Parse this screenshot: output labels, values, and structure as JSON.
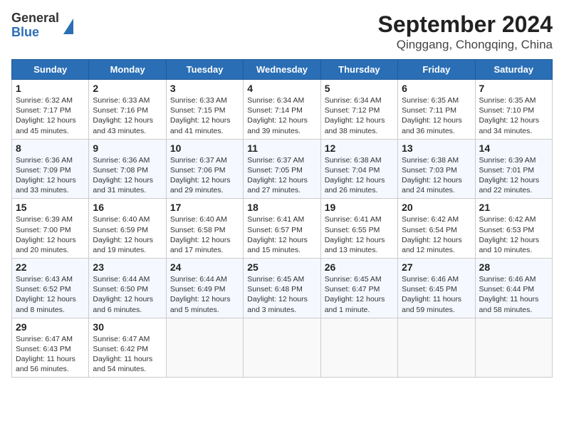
{
  "logo": {
    "line1": "General",
    "line2": "Blue"
  },
  "title": "September 2024",
  "subtitle": "Qinggang, Chongqing, China",
  "days_of_week": [
    "Sunday",
    "Monday",
    "Tuesday",
    "Wednesday",
    "Thursday",
    "Friday",
    "Saturday"
  ],
  "weeks": [
    [
      {
        "day": 1,
        "info": "Sunrise: 6:32 AM\nSunset: 7:17 PM\nDaylight: 12 hours\nand 45 minutes."
      },
      {
        "day": 2,
        "info": "Sunrise: 6:33 AM\nSunset: 7:16 PM\nDaylight: 12 hours\nand 43 minutes."
      },
      {
        "day": 3,
        "info": "Sunrise: 6:33 AM\nSunset: 7:15 PM\nDaylight: 12 hours\nand 41 minutes."
      },
      {
        "day": 4,
        "info": "Sunrise: 6:34 AM\nSunset: 7:14 PM\nDaylight: 12 hours\nand 39 minutes."
      },
      {
        "day": 5,
        "info": "Sunrise: 6:34 AM\nSunset: 7:12 PM\nDaylight: 12 hours\nand 38 minutes."
      },
      {
        "day": 6,
        "info": "Sunrise: 6:35 AM\nSunset: 7:11 PM\nDaylight: 12 hours\nand 36 minutes."
      },
      {
        "day": 7,
        "info": "Sunrise: 6:35 AM\nSunset: 7:10 PM\nDaylight: 12 hours\nand 34 minutes."
      }
    ],
    [
      {
        "day": 8,
        "info": "Sunrise: 6:36 AM\nSunset: 7:09 PM\nDaylight: 12 hours\nand 33 minutes."
      },
      {
        "day": 9,
        "info": "Sunrise: 6:36 AM\nSunset: 7:08 PM\nDaylight: 12 hours\nand 31 minutes."
      },
      {
        "day": 10,
        "info": "Sunrise: 6:37 AM\nSunset: 7:06 PM\nDaylight: 12 hours\nand 29 minutes."
      },
      {
        "day": 11,
        "info": "Sunrise: 6:37 AM\nSunset: 7:05 PM\nDaylight: 12 hours\nand 27 minutes."
      },
      {
        "day": 12,
        "info": "Sunrise: 6:38 AM\nSunset: 7:04 PM\nDaylight: 12 hours\nand 26 minutes."
      },
      {
        "day": 13,
        "info": "Sunrise: 6:38 AM\nSunset: 7:03 PM\nDaylight: 12 hours\nand 24 minutes."
      },
      {
        "day": 14,
        "info": "Sunrise: 6:39 AM\nSunset: 7:01 PM\nDaylight: 12 hours\nand 22 minutes."
      }
    ],
    [
      {
        "day": 15,
        "info": "Sunrise: 6:39 AM\nSunset: 7:00 PM\nDaylight: 12 hours\nand 20 minutes."
      },
      {
        "day": 16,
        "info": "Sunrise: 6:40 AM\nSunset: 6:59 PM\nDaylight: 12 hours\nand 19 minutes."
      },
      {
        "day": 17,
        "info": "Sunrise: 6:40 AM\nSunset: 6:58 PM\nDaylight: 12 hours\nand 17 minutes."
      },
      {
        "day": 18,
        "info": "Sunrise: 6:41 AM\nSunset: 6:57 PM\nDaylight: 12 hours\nand 15 minutes."
      },
      {
        "day": 19,
        "info": "Sunrise: 6:41 AM\nSunset: 6:55 PM\nDaylight: 12 hours\nand 13 minutes."
      },
      {
        "day": 20,
        "info": "Sunrise: 6:42 AM\nSunset: 6:54 PM\nDaylight: 12 hours\nand 12 minutes."
      },
      {
        "day": 21,
        "info": "Sunrise: 6:42 AM\nSunset: 6:53 PM\nDaylight: 12 hours\nand 10 minutes."
      }
    ],
    [
      {
        "day": 22,
        "info": "Sunrise: 6:43 AM\nSunset: 6:52 PM\nDaylight: 12 hours\nand 8 minutes."
      },
      {
        "day": 23,
        "info": "Sunrise: 6:44 AM\nSunset: 6:50 PM\nDaylight: 12 hours\nand 6 minutes."
      },
      {
        "day": 24,
        "info": "Sunrise: 6:44 AM\nSunset: 6:49 PM\nDaylight: 12 hours\nand 5 minutes."
      },
      {
        "day": 25,
        "info": "Sunrise: 6:45 AM\nSunset: 6:48 PM\nDaylight: 12 hours\nand 3 minutes."
      },
      {
        "day": 26,
        "info": "Sunrise: 6:45 AM\nSunset: 6:47 PM\nDaylight: 12 hours\nand 1 minute."
      },
      {
        "day": 27,
        "info": "Sunrise: 6:46 AM\nSunset: 6:45 PM\nDaylight: 11 hours\nand 59 minutes."
      },
      {
        "day": 28,
        "info": "Sunrise: 6:46 AM\nSunset: 6:44 PM\nDaylight: 11 hours\nand 58 minutes."
      }
    ],
    [
      {
        "day": 29,
        "info": "Sunrise: 6:47 AM\nSunset: 6:43 PM\nDaylight: 11 hours\nand 56 minutes."
      },
      {
        "day": 30,
        "info": "Sunrise: 6:47 AM\nSunset: 6:42 PM\nDaylight: 11 hours\nand 54 minutes."
      },
      null,
      null,
      null,
      null,
      null
    ]
  ]
}
